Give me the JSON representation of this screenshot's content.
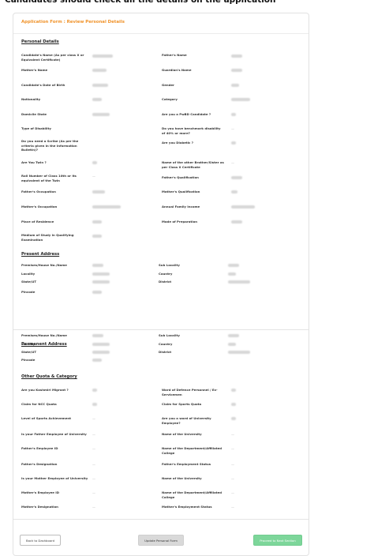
{
  "top_note": "Candidates should check all the details on the application",
  "form_title": "Application Form : Review Personal Details",
  "sections": {
    "personal": "Personal Details",
    "present": "Present Address",
    "permanent": "Permanent Address",
    "quota": "Other Quota & Category"
  },
  "personal_labels": {
    "name": "Candidate's Name (As per class X or Equivalent Certificate)",
    "father": "Father's Name",
    "mother": "Mother's Name",
    "guardian": "Guardian's Name",
    "dob": "Candidate's Date of Birth",
    "gender": "Gender",
    "nationality": "Nationality",
    "category": "Category",
    "domicile": "Domicile State",
    "pwbd": "Are you a PwBD Candidate ?",
    "disability_type": "Type of Disability",
    "benchmark": "Do you have benchmark disability of 40% or more?",
    "scribe": "Do you need a Scribe (As per the criteria given in the Information Bulletin)?",
    "diabetic": "Are you Diabetic ?",
    "twin": "Are You Twin ?",
    "twin_name": "Name of the other Brother/Sister as per Class X Certificate",
    "roll": "Roll Number of Class 10th or its equivalent of the Twin",
    "father_qual": "Father's Qualification",
    "father_occ": "Father's Occupation",
    "mother_qual": "Mother's Qualification",
    "mother_occ": "Mother's Occupation",
    "income": "Annual Family Income",
    "residence": "Place of Residence",
    "preparation": "Mode of Preparation",
    "medium": "Medium of Study in Qualifying Examination"
  },
  "address_labels": {
    "premises": "Premises/House No./Name",
    "sub_locality": "Sub Locality",
    "locality": "Locality",
    "country": "Country",
    "state": "State/UT",
    "district": "District",
    "pincode": "Pincode"
  },
  "quota_labels": {
    "kashmiri": "Are you Kashmiri Migrant ?",
    "ward_defence": "Ward of Defence Personnel / Ex-Servicemen",
    "ncc": "Claim for NCC Quota",
    "sports": "Claim for Sports Quota",
    "sports_level": "Level of Sports Achievement",
    "ward_univ": "Are you a ward of University Employee?",
    "father_emp": "Is your Father Employee of University",
    "univ_name": "Name of the University",
    "father_emp_id": "Father's Employee ID",
    "dept_name": "Name of the Department/Affiliated College",
    "father_desig": "Father's Designation",
    "father_status": "Father's Employment Status",
    "mother_emp": "Is your Mother Employee of University",
    "mother_emp_id": "Mother's Employee ID",
    "mother_desig": "Mother's Designation",
    "mother_status": "Mother's Employment Status"
  },
  "buttons": {
    "back": "Back to Dashboard",
    "update": "Update Personal Form",
    "next": "Proceed to Next Section"
  },
  "dash": "—"
}
